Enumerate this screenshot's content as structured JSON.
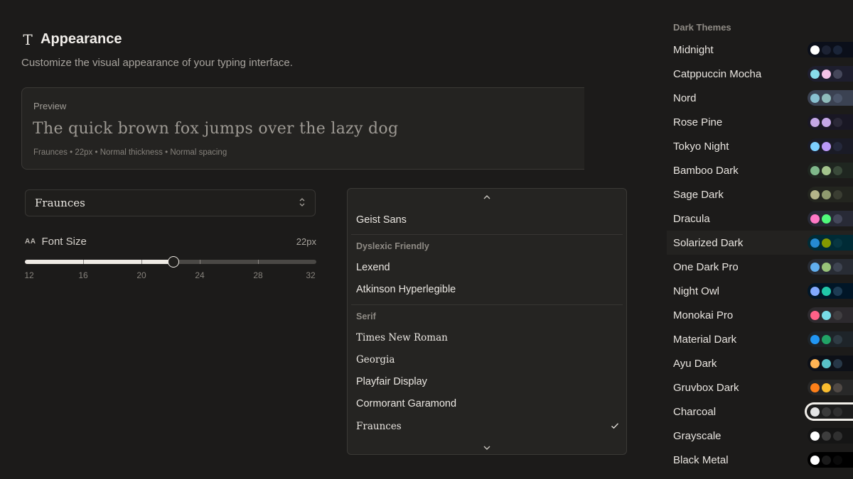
{
  "header": {
    "icon": "text-t-icon",
    "title": "Appearance",
    "subtitle": "Customize the visual appearance of your typing interface."
  },
  "preview": {
    "label": "Preview",
    "sample_text": "The quick brown fox jumps over the lazy dog",
    "meta": "Fraunces • 22px • Normal thickness • Normal spacing"
  },
  "font_select": {
    "value": "Fraunces",
    "icon": "chevron-up-down-icon"
  },
  "font_size": {
    "icon": "font-size-icon",
    "icon_text": "AA",
    "label": "Font Size",
    "value_text": "22px",
    "value": 22,
    "min": 12,
    "max": 32,
    "ticks": [
      "12",
      "16",
      "20",
      "24",
      "28",
      "32"
    ]
  },
  "font_dropdown": {
    "items": [
      {
        "kind": "item",
        "label": "Geist Sans",
        "serif": false,
        "selected": false
      },
      {
        "kind": "separator"
      },
      {
        "kind": "group",
        "label": "Dyslexic Friendly"
      },
      {
        "kind": "item",
        "label": "Lexend",
        "serif": false,
        "selected": false
      },
      {
        "kind": "item",
        "label": "Atkinson Hyperlegible",
        "serif": false,
        "selected": false
      },
      {
        "kind": "separator"
      },
      {
        "kind": "group",
        "label": "Serif"
      },
      {
        "kind": "item",
        "label": "Times New Roman",
        "serif": true,
        "selected": false
      },
      {
        "kind": "item",
        "label": "Georgia",
        "serif": true,
        "selected": false
      },
      {
        "kind": "item",
        "label": "Playfair Display",
        "serif": false,
        "selected": false
      },
      {
        "kind": "item",
        "label": "Cormorant Garamond",
        "serif": false,
        "selected": false
      },
      {
        "kind": "item",
        "label": "Fraunces",
        "serif": true,
        "selected": true
      }
    ]
  },
  "themes": {
    "heading": "Dark Themes",
    "items": [
      {
        "name": "Midnight",
        "colors": [
          "#ffffff",
          "#1c2233",
          "#1a2438"
        ],
        "bg": "#0b0f1a",
        "selected": false
      },
      {
        "name": "Catppuccin Mocha",
        "colors": [
          "#89dceb",
          "#f5c2e7",
          "#45475a"
        ],
        "bg": "#1e1e2e",
        "selected": false
      },
      {
        "name": "Nord",
        "colors": [
          "#88c0d0",
          "#8fbcbb",
          "#4c566a"
        ],
        "bg": "#3b4252",
        "selected": false
      },
      {
        "name": "Rose Pine",
        "colors": [
          "#c4a7e7",
          "#c4a7e7",
          "#2a2837"
        ],
        "bg": "#191724",
        "selected": false
      },
      {
        "name": "Tokyo Night",
        "colors": [
          "#7dcfff",
          "#bb9af7",
          "#24283b"
        ],
        "bg": "#1a1b26",
        "selected": false
      },
      {
        "name": "Bamboo Dark",
        "colors": [
          "#7fb88a",
          "#a3c48c",
          "#3a4a3a"
        ],
        "bg": "#1f2620",
        "selected": false
      },
      {
        "name": "Sage Dark",
        "colors": [
          "#b5b48a",
          "#8f9a6f",
          "#3a3d32"
        ],
        "bg": "#23251f",
        "selected": false
      },
      {
        "name": "Dracula",
        "colors": [
          "#ff79c6",
          "#50fa7b",
          "#44475a"
        ],
        "bg": "#282a36",
        "selected": false
      },
      {
        "name": "Solarized Dark",
        "colors": [
          "#268bd2",
          "#859900",
          "#073642"
        ],
        "bg": "#002b36",
        "selected": false
      },
      {
        "name": "One Dark Pro",
        "colors": [
          "#61afef",
          "#98c379",
          "#3e4451"
        ],
        "bg": "#282c34",
        "selected": false
      },
      {
        "name": "Night Owl",
        "colors": [
          "#82aaff",
          "#21c7a8",
          "#1d3b53"
        ],
        "bg": "#011627",
        "selected": false
      },
      {
        "name": "Monokai Pro",
        "colors": [
          "#ff6188",
          "#78dce8",
          "#403e41"
        ],
        "bg": "#2d2a2e",
        "selected": false
      },
      {
        "name": "Material Dark",
        "colors": [
          "#2196f3",
          "#21a366",
          "#2f3b44"
        ],
        "bg": "#1e2429",
        "selected": false
      },
      {
        "name": "Ayu Dark",
        "colors": [
          "#ffb454",
          "#59c2c7",
          "#273747"
        ],
        "bg": "#0d1017",
        "selected": false
      },
      {
        "name": "Gruvbox Dark",
        "colors": [
          "#fe8019",
          "#fabd2f",
          "#504945"
        ],
        "bg": "#282828",
        "selected": false
      },
      {
        "name": "Charcoal",
        "colors": [
          "#e5e5e5",
          "#3a3a3a",
          "#2f2f2f"
        ],
        "bg": "#1c1c1c",
        "selected": true
      },
      {
        "name": "Grayscale",
        "colors": [
          "#ffffff",
          "#3d3d3d",
          "#303030"
        ],
        "bg": "#151515",
        "selected": false
      },
      {
        "name": "Black Metal",
        "colors": [
          "#ffffff",
          "#1a1a1a",
          "#0a0a0a"
        ],
        "bg": "#000000",
        "selected": false
      }
    ]
  }
}
